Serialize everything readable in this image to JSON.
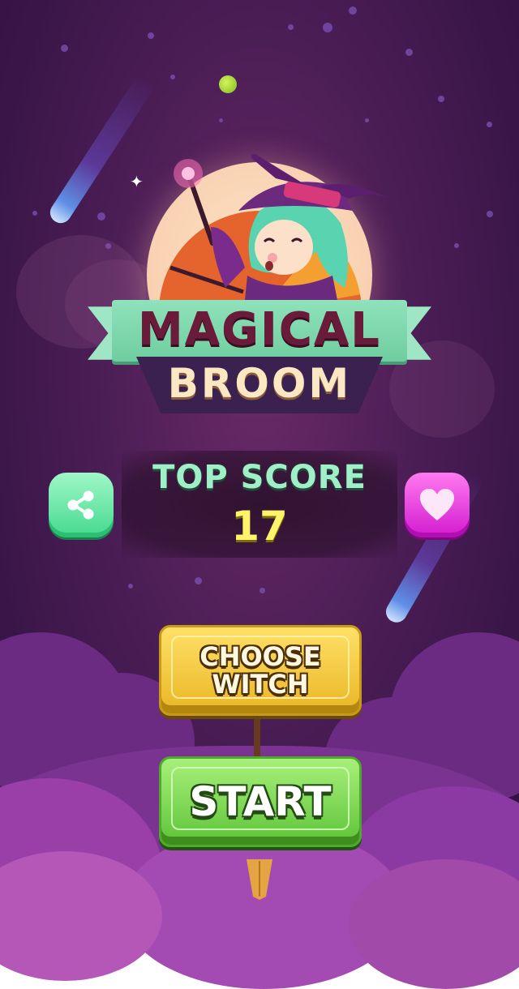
{
  "game": {
    "title_line1": "MAGICAL",
    "title_line2": "BROOM"
  },
  "score": {
    "label": "TOP SCORE",
    "value": "17"
  },
  "buttons": {
    "choose_witch": "CHOOSE\nWITCH",
    "start": "START",
    "share_icon": "share-icon",
    "heart_icon": "heart-icon"
  },
  "colors": {
    "background": "#4a1d55",
    "title_primary": "#6b1b3a",
    "banner_green": "#8fe2bb",
    "score_label": "#9ff0c8",
    "score_value": "#fff36a",
    "choose_button": "#e9b624",
    "start_button": "#5ec338",
    "share_button": "#45d98e",
    "heart_button": "#d31ad0"
  }
}
